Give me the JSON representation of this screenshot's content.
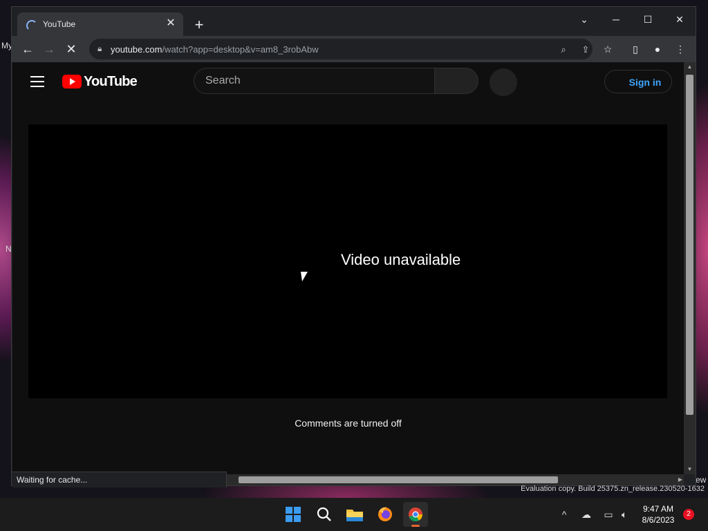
{
  "desktop": {
    "left_text_1": "My",
    "left_text_2": "N",
    "right_text": "ew"
  },
  "browser": {
    "tab": {
      "title": "YouTube"
    },
    "url": {
      "host": "youtube.com",
      "path": "/watch?app=desktop&v=am8_3robAbw"
    },
    "status_text": "Waiting for cache..."
  },
  "youtube": {
    "logo_text": "YouTube",
    "search": {
      "placeholder": "Search"
    },
    "signin_label": "Sign in",
    "player_message": "Video unavailable",
    "comments_text": "Comments are turned off"
  },
  "watermark": "Evaluation copy. Build 25375.zn_release.230520-1632",
  "taskbar": {
    "time": "9:47 AM",
    "date": "8/6/2023",
    "notification_count": "2"
  }
}
